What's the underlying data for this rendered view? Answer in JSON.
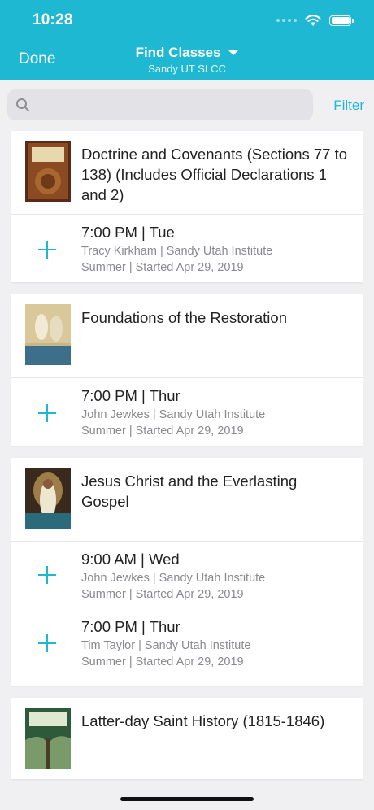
{
  "status": {
    "time": "10:28"
  },
  "nav": {
    "done_label": "Done",
    "title": "Find Classes",
    "subtitle": "Sandy UT SLCC"
  },
  "search": {
    "placeholder": ""
  },
  "filter_label": "Filter",
  "courses": [
    {
      "title": "Doctrine and Covenants (Sections 77 to 138) (Includes Official Declarations 1 and 2)",
      "thumb_colors": [
        "#5a2a18",
        "#a8672e"
      ],
      "sessions": [
        {
          "time": "7:00 PM | Tue",
          "instructor": "Tracy Kirkham | Sandy Utah Institute",
          "term": "Summer | Started Apr 29, 2019"
        }
      ]
    },
    {
      "title": "Foundations of the Restoration",
      "thumb_colors": [
        "#c9b58a",
        "#3d6e8a"
      ],
      "sessions": [
        {
          "time": "7:00 PM | Thur",
          "instructor": "John Jewkes | Sandy Utah Institute",
          "term": "Summer | Started Apr 29, 2019"
        }
      ]
    },
    {
      "title": "Jesus Christ and the Everlasting Gospel",
      "thumb_colors": [
        "#3a2a1e",
        "#c8a25a"
      ],
      "sessions": [
        {
          "time": "9:00 AM | Wed",
          "instructor": "John Jewkes | Sandy Utah Institute",
          "term": "Summer | Started Apr 29, 2019"
        },
        {
          "time": "7:00 PM | Thur",
          "instructor": "Tim Taylor | Sandy Utah Institute",
          "term": "Summer | Started Apr 29, 2019"
        }
      ]
    },
    {
      "title": "Latter-day Saint History (1815-1846)",
      "thumb_colors": [
        "#2f5a3a",
        "#7a9a6a"
      ],
      "sessions": []
    }
  ],
  "colors": {
    "accent": "#1fb8d3",
    "background": "#f0f0f2"
  }
}
